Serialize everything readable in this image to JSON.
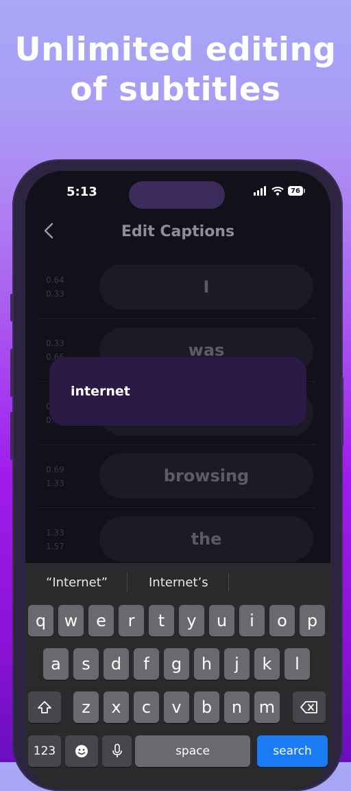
{
  "headline": {
    "line1": "Unlimited editing",
    "line2": "of subtitles"
  },
  "status_bar": {
    "time": "5:13",
    "battery": "76"
  },
  "nav": {
    "title": "Edit Captions",
    "back_icon": "chevron-left-icon"
  },
  "captions": [
    {
      "start": "0.64",
      "end": "0.33",
      "text": "I"
    },
    {
      "start": "0.33",
      "end": "0.66",
      "text": "was"
    },
    {
      "start": "0.",
      "end": "0.",
      "text": ""
    },
    {
      "start": "0.69",
      "end": "1.33",
      "text": "browsing"
    },
    {
      "start": "1.33",
      "end": "1.57",
      "text": "the"
    }
  ],
  "editor": {
    "value": "internet"
  },
  "keyboard": {
    "suggestions": [
      "“Internet”",
      "Internet’s"
    ],
    "row1": [
      "q",
      "w",
      "e",
      "r",
      "t",
      "y",
      "u",
      "i",
      "o",
      "p"
    ],
    "row2": [
      "a",
      "s",
      "d",
      "f",
      "g",
      "h",
      "j",
      "k",
      "l"
    ],
    "row3": [
      "z",
      "x",
      "c",
      "v",
      "b",
      "n",
      "m"
    ],
    "numbers_label": "123",
    "space_label": "space",
    "action_label": "search"
  },
  "colors": {
    "accent": "#1a7cf5",
    "editor_bg": "#2a1a45",
    "frame": "#2c2440"
  }
}
